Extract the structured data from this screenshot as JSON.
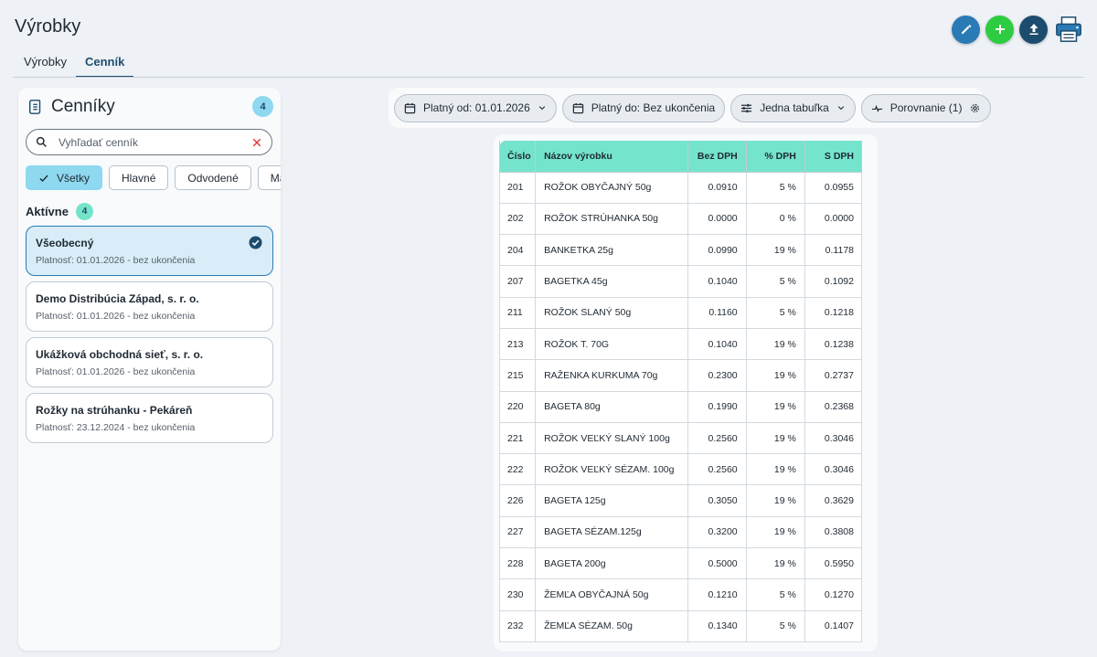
{
  "header": {
    "title": "Výrobky",
    "tabs": [
      {
        "label": "Výrobky",
        "active": false
      },
      {
        "label": "Cenník",
        "active": true
      }
    ]
  },
  "actions": [
    "edit-icon",
    "plus-icon",
    "upload-icon",
    "printer-icon"
  ],
  "colors": {
    "accent": "#1d4d6e",
    "edit": "#2a7ab6",
    "add": "#2ecc40",
    "table_header": "#74e4cc",
    "selected": "#d8edf7"
  },
  "sidebar": {
    "title": "Cenníky",
    "count": "4",
    "search": {
      "placeholder": "Vyhľadať cenník",
      "value": ""
    },
    "filters": [
      {
        "label": "Všetky",
        "active": true
      },
      {
        "label": "Hlavné",
        "active": false
      },
      {
        "label": "Odvodené",
        "active": false
      },
      {
        "label": "Ma",
        "active": false
      }
    ],
    "section": {
      "title": "Aktívne",
      "count": "4"
    },
    "items": [
      {
        "name": "Všeobecný",
        "validity": "Platnosť: 01.01.2026 - bez ukončenia",
        "selected": true
      },
      {
        "name": "Demo Distribúcia Západ, s. r. o.",
        "validity": "Platnosť: 01.01.2026 - bez ukončenia",
        "selected": false
      },
      {
        "name": "Ukážková obchodná sieť, s. r. o.",
        "validity": "Platnosť: 01.01.2026 - bez ukončenia",
        "selected": false
      },
      {
        "name": "Rožky na strúhanku - Pekáreň",
        "validity": "Platnosť: 23.12.2024 - bez ukončenia",
        "selected": false
      }
    ]
  },
  "toolbar": {
    "valid_from": "Platný od: 01.01.2026",
    "valid_to": "Platný do: Bez ukončenia",
    "view": "Jedna tabuľka",
    "compare": "Porovnanie (1)"
  },
  "table": {
    "columns": [
      "Číslo",
      "Názov výrobku",
      "Bez DPH",
      "% DPH",
      "S DPH"
    ],
    "rows": [
      [
        "201",
        "ROŽOK OBYČAJNÝ 50g",
        "0.0910",
        "5 %",
        "0.0955"
      ],
      [
        "202",
        "ROŽOK STRÚHANKA 50g",
        "0.0000",
        "0 %",
        "0.0000"
      ],
      [
        "204",
        "BANKETKA 25g",
        "0.0990",
        "19 %",
        "0.1178"
      ],
      [
        "207",
        "BAGETKA 45g",
        "0.1040",
        "5 %",
        "0.1092"
      ],
      [
        "211",
        "ROŽOK SLANÝ 50g",
        "0.1160",
        "5 %",
        "0.1218"
      ],
      [
        "213",
        "ROŽOK T. 70G",
        "0.1040",
        "19 %",
        "0.1238"
      ],
      [
        "215",
        "RAŽENKA KURKUMA 70g",
        "0.2300",
        "19 %",
        "0.2737"
      ],
      [
        "220",
        "BAGETA 80g",
        "0.1990",
        "19 %",
        "0.2368"
      ],
      [
        "221",
        "ROŽOK VEĽKÝ SLANÝ 100g",
        "0.2560",
        "19 %",
        "0.3046"
      ],
      [
        "222",
        "ROŽOK VEĽKÝ SÉZAM. 100g",
        "0.2560",
        "19 %",
        "0.3046"
      ],
      [
        "226",
        "BAGETA 125g",
        "0.3050",
        "19 %",
        "0.3629"
      ],
      [
        "227",
        "BAGETA SÉZAM.125g",
        "0.3200",
        "19 %",
        "0.3808"
      ],
      [
        "228",
        "BAGETA 200g",
        "0.5000",
        "19 %",
        "0.5950"
      ],
      [
        "230",
        "ŽEMĽA OBYČAJNÁ 50g",
        "0.1210",
        "5 %",
        "0.1270"
      ],
      [
        "232",
        "ŽEMĽA SÉZAM. 50g",
        "0.1340",
        "5 %",
        "0.1407"
      ]
    ]
  }
}
